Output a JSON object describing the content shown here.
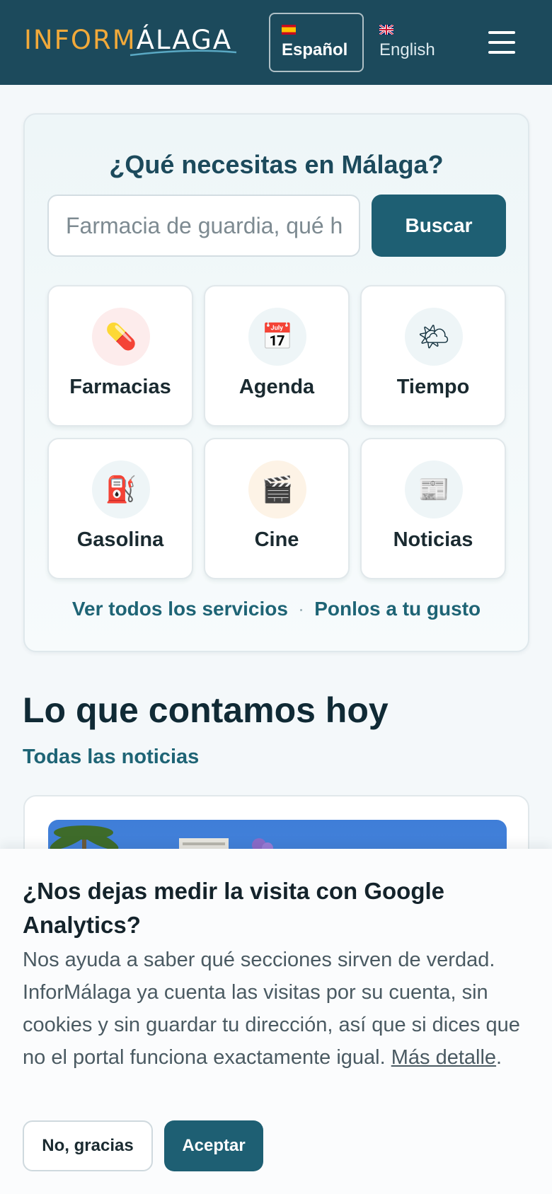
{
  "header": {
    "logo_part1": "INFORM",
    "logo_part2": "ÁLAGA",
    "lang_es": {
      "label": "Español",
      "flag": "spain-flag-icon",
      "active": true
    },
    "lang_en": {
      "label": "English",
      "flag": "uk-flag-icon",
      "active": false
    },
    "menu_icon": "hamburger-menu-icon"
  },
  "search": {
    "title": "¿Qué necesitas en Málaga?",
    "placeholder": "Farmacia de guardia, qué hay hoy...",
    "button_label": "Buscar",
    "tiles": [
      {
        "label": "Farmacias",
        "icon": "pill-icon",
        "glyph": "💊",
        "icon_bg": "#fdecec"
      },
      {
        "label": "Agenda",
        "icon": "calendar-icon",
        "glyph": "📅",
        "icon_bg": "#eef5f7"
      },
      {
        "label": "Tiempo",
        "icon": "weather-icon",
        "glyph": "🌤",
        "icon_bg": "#eef5f7"
      },
      {
        "label": "Gasolina",
        "icon": "fuel-pump-icon",
        "glyph": "⛽",
        "icon_bg": "#eef5f7"
      },
      {
        "label": "Cine",
        "icon": "clapperboard-icon",
        "glyph": "🎬",
        "icon_bg": "#fdf3e6"
      },
      {
        "label": "Noticias",
        "icon": "newspaper-icon",
        "glyph": "📰",
        "icon_bg": "#eef5f7"
      }
    ],
    "link_all_services": "Ver todos los servicios",
    "link_separator": "·",
    "link_customize": "Ponlos a tu gusto"
  },
  "news": {
    "title": "Lo que contamos hoy",
    "all_news_link": "Todas las noticias"
  },
  "consent": {
    "title": "¿Nos dejas medir la visita con Google Analytics?",
    "body": "Nos ayuda a saber qué secciones sirven de verdad. InforMálaga ya cuenta las visitas por su cuenta, sin cookies y sin guardar tu dirección, así que si dices que no el portal funciona exactamente igual.",
    "more_link": "Más detalle",
    "more_suffix": ".",
    "decline_label": "No, gracias",
    "accept_label": "Aceptar"
  },
  "colors": {
    "header_bg": "#1c4a5c",
    "accent": "#1e5f73",
    "logo_orange": "#f1a93a"
  }
}
